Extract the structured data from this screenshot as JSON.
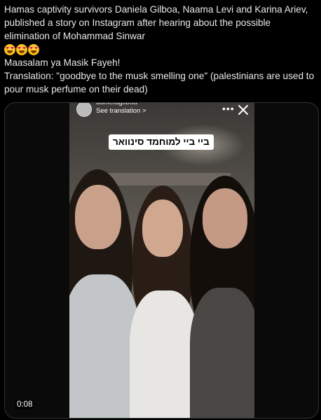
{
  "tweet": {
    "line1": "Hamas captivity survivors Daniela Gilboa, Naama Levi and Karina Ariev, published a story on Instagram after hearing about the possible elimination of Mohammad Sinwar",
    "emoji_name": "smiling-face-with-heart-eyes",
    "emoji_count": 3,
    "line2": "Maasalam ya Masik Fayeh!",
    "line3": "Translation: \"goodbye to the musk smelling one\" (palestinians are used to pour musk perfume on their dead)"
  },
  "video": {
    "ig_username": "danielagilboa",
    "ig_translate": "See translation >",
    "more_icon": "more-icon",
    "close_icon": "close-icon",
    "hebrew_banner": "ביי ביי למוחמד סינוואר",
    "timestamp": "0:08"
  }
}
